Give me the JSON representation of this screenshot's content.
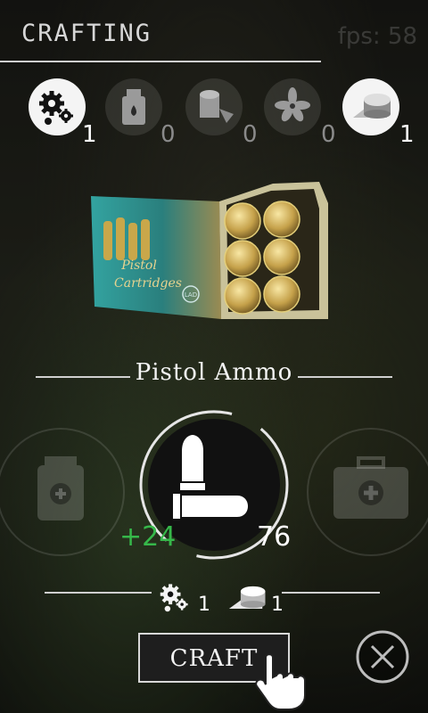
{
  "header": {
    "title": "CRAFTING",
    "fps": "fps: 58"
  },
  "resources": [
    {
      "icon": "gears-icon",
      "count": "1",
      "active": true
    },
    {
      "icon": "bottle-icon",
      "count": "0",
      "active": false
    },
    {
      "icon": "duct-tape-icon",
      "count": "0",
      "active": false
    },
    {
      "icon": "herb-icon",
      "count": "0",
      "active": false
    },
    {
      "icon": "gunpowder-icon",
      "count": "1",
      "active": true
    }
  ],
  "ammo_box": {
    "label_line1": "Pistol",
    "label_line2": "Cartridges",
    "badge": "LAD"
  },
  "item": {
    "name": "Pistol Ammo",
    "gain": "+24",
    "total": "76"
  },
  "cost": [
    {
      "icon": "gears-icon",
      "count": "1"
    },
    {
      "icon": "gunpowder-icon",
      "count": "1"
    }
  ],
  "actions": {
    "craft_label": "CRAFT"
  },
  "colors": {
    "gain": "#36b84a",
    "accent": "#f4f4f4"
  }
}
